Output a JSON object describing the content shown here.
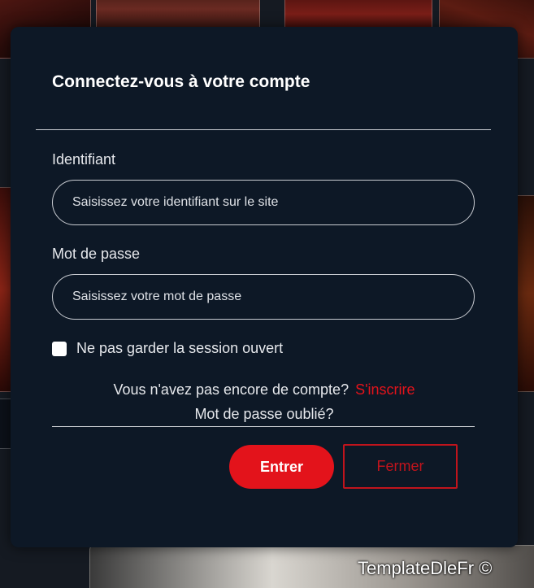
{
  "modal": {
    "title": "Connectez-vous à votre compte",
    "login_label": "Identifiant",
    "login_placeholder": "Saisissez votre identifiant sur le site",
    "password_label": "Mot de passe",
    "password_placeholder": "Saisissez votre mot de passe",
    "remember_label": "Ne pas garder la session ouvert",
    "no_account_text": "Vous n'avez pas encore de compte?",
    "register_link": "S'inscrire",
    "forgot_link": "Mot de passe oublié?",
    "enter_button": "Entrer",
    "close_button": "Fermer"
  },
  "watermark": "TemplateDleFr ©",
  "colors": {
    "accent": "#e3131b",
    "modal_bg": "#0d1826"
  }
}
